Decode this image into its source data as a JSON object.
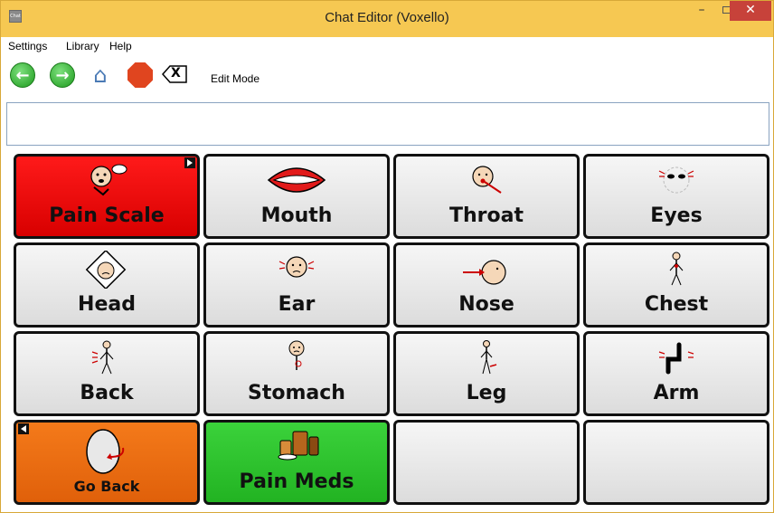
{
  "window": {
    "title": "Chat Editor (Voxello)",
    "app_icon_text": "Chat",
    "controls": {
      "minimize": "–",
      "close": "✕"
    }
  },
  "menu": [
    "Settings",
    "Library",
    "Help"
  ],
  "toolbar": {
    "back_icon": "back-arrow-icon",
    "forward_icon": "forward-arrow-icon",
    "home_icon": "home-icon",
    "stop_icon": "stop-icon",
    "clear_icon": "clear-text-icon",
    "clear_glyph": "X",
    "mode_label": "Edit Mode"
  },
  "message_bar": {
    "value": ""
  },
  "buttons": [
    {
      "label": "Pain Scale",
      "color": "#e00000",
      "icon": "pain-scale-face-icon",
      "has_link": true
    },
    {
      "label": "Mouth",
      "color": "#e8e8e8",
      "icon": "mouth-icon"
    },
    {
      "label": "Throat",
      "color": "#e8e8e8",
      "icon": "throat-icon"
    },
    {
      "label": "Eyes",
      "color": "#e8e8e8",
      "icon": "eyes-icon"
    },
    {
      "label": "Head",
      "color": "#e8e8e8",
      "icon": "head-icon"
    },
    {
      "label": "Ear",
      "color": "#e8e8e8",
      "icon": "ear-icon"
    },
    {
      "label": "Nose",
      "color": "#e8e8e8",
      "icon": "nose-icon"
    },
    {
      "label": "Chest",
      "color": "#e8e8e8",
      "icon": "chest-icon"
    },
    {
      "label": "Back",
      "color": "#e8e8e8",
      "icon": "back-body-icon"
    },
    {
      "label": "Stomach",
      "color": "#e8e8e8",
      "icon": "stomach-icon"
    },
    {
      "label": "Leg",
      "color": "#e8e8e8",
      "icon": "leg-icon"
    },
    {
      "label": "Arm",
      "color": "#e8e8e8",
      "icon": "arm-icon"
    },
    {
      "label": "Go Back",
      "color": "#f07018",
      "icon": "go-back-icon",
      "has_back_link": true
    },
    {
      "label": "Pain Meds",
      "color": "#2ec12e",
      "icon": "pain-meds-icon"
    },
    {
      "label": "",
      "color": "#e8e8e8",
      "icon": ""
    },
    {
      "label": "",
      "color": "#e8e8e8",
      "icon": ""
    }
  ]
}
